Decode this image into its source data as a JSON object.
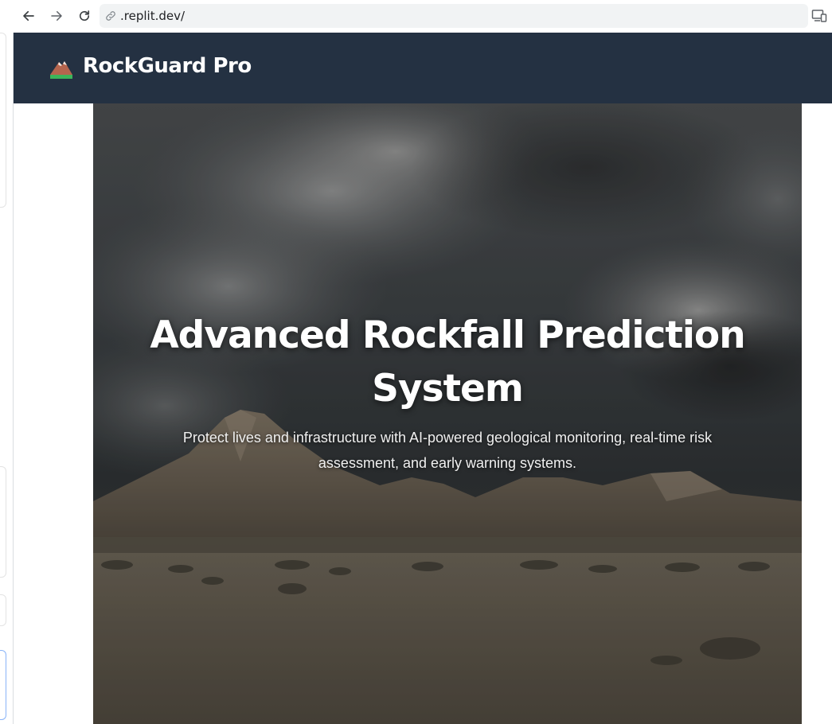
{
  "browser": {
    "url": ".replit.dev/",
    "icons": [
      "back-arrow-icon",
      "forward-arrow-icon",
      "reload-icon",
      "site-info-icon",
      "devices-icon"
    ]
  },
  "header": {
    "brand": "RockGuard Pro",
    "logo_icon": "mountain-icon",
    "background": "#243142"
  },
  "hero": {
    "title": "Advanced Rockfall Prediction System",
    "subtitle": "Protect lives and infrastructure with AI-powered geological monitoring, real-time risk assessment, and early warning systems.",
    "image": "stormy-desert-mountain-photo"
  }
}
